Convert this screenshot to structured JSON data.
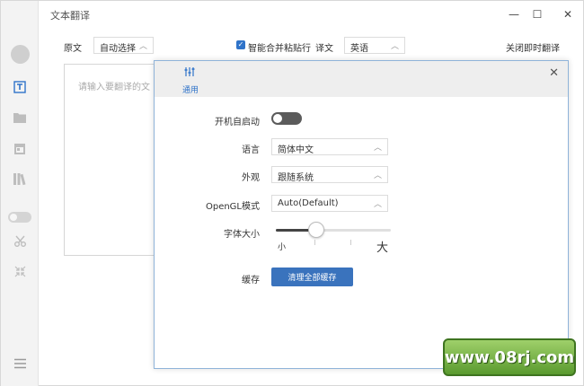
{
  "app": {
    "title": "文本翻译"
  },
  "window_controls": {
    "minimize": "—",
    "maximize": "☐",
    "close": "✕"
  },
  "toolbar": {
    "source_label": "原文",
    "source_lang": "自动选择",
    "merge_label": "智能合并粘贴行",
    "merge_checked": true,
    "target_label": "译文",
    "target_lang": "英语",
    "instant_translate": "关闭即时翻译"
  },
  "source": {
    "placeholder": "请输入要翻译的文"
  },
  "sidebar": {
    "items": [
      {
        "name": "text-translate-icon",
        "active": true
      },
      {
        "name": "folder-icon"
      },
      {
        "name": "calendar-icon"
      },
      {
        "name": "library-icon"
      },
      {
        "name": "toggle-icon"
      },
      {
        "name": "scissors-icon"
      },
      {
        "name": "collapse-icon"
      },
      {
        "name": "menu-icon"
      }
    ]
  },
  "settings": {
    "tab_label": "通用",
    "autostart_label": "开机自启动",
    "autostart_on": false,
    "language_label": "语言",
    "language_value": "简体中文",
    "appearance_label": "外观",
    "appearance_value": "跟随系统",
    "opengl_label": "OpenGL模式",
    "opengl_value": "Auto(Default)",
    "fontsize_label": "字体大小",
    "fontsize_small": "小",
    "fontsize_large": "大",
    "fontsize_level": 0.35,
    "cache_label": "缓存",
    "clear_cache_button": "清理全部缓存"
  },
  "watermark": {
    "text": "www.08rj.com"
  }
}
